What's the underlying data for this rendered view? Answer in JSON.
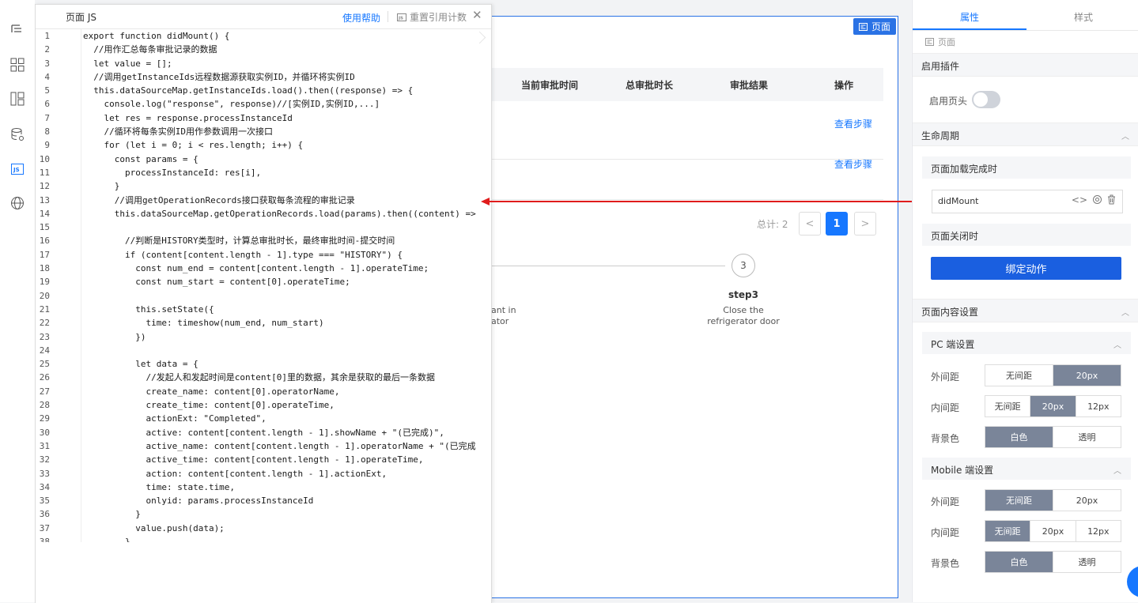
{
  "editor": {
    "title": "页面 JS",
    "help": "使用帮助",
    "reset": "重置引用计数",
    "close": "✕",
    "reset_icon": "JS",
    "lines": [
      "export function didMount() {",
      "  //用作汇总每条审批记录的数据",
      "  let value = [];",
      "  //调用getInstanceIds远程数据源获取实例ID，并循环将实例ID",
      "  this.dataSourceMap.getInstanceIds.load().then((response) => {",
      "    console.log(\"response\", response)//[实例ID,实例ID,...]",
      "    let res = response.processInstanceId",
      "    //循环将每条实例ID用作参数调用一次接口",
      "    for (let i = 0; i < res.length; i++) {",
      "      const params = {",
      "        processInstanceId: res[i],",
      "      }",
      "      //调用getOperationRecords接口获取每条流程的审批记录",
      "      this.dataSourceMap.getOperationRecords.load(params).then((content) =>",
      "",
      "        //判断是HISTORY类型时，计算总审批时长，最终审批时间-提交时间",
      "        if (content[content.length - 1].type === \"HISTORY\") {",
      "          const num_end = content[content.length - 1].operateTime;",
      "          const num_start = content[0].operateTime;",
      "",
      "          this.setState({",
      "            time: timeshow(num_end, num_start)",
      "          })",
      "",
      "          let data = {",
      "            //发起人和发起时间是content[0]里的数据，其余是获取的最后一条数据",
      "            create_name: content[0].operatorName,",
      "            create_time: content[0].operateTime,",
      "            actionExt: \"Completed\",",
      "            active: content[content.length - 1].showName + \"(已完成)\",",
      "            active_name: content[content.length - 1].operatorName + \"(已完成",
      "            active_time: content[content.length - 1].operateTime,",
      "            action: content[content.length - 1].actionExt,",
      "            time: state.time,",
      "            onlyid: params.processInstanceId",
      "          }",
      "          value.push(data);",
      "        }"
    ],
    "line_numbers": [
      "1",
      "2",
      "3",
      "4",
      "5",
      "6",
      "7",
      "8",
      "9",
      "10",
      "11",
      "12",
      "13",
      "14",
      "15",
      "16",
      "17",
      "18",
      "19",
      "20",
      "21",
      "22",
      "23",
      "24",
      "25",
      "26",
      "27",
      "28",
      "29",
      "30",
      "31",
      "32",
      "33",
      "34",
      "35",
      "36",
      "37",
      "38"
    ]
  },
  "canvas": {
    "page_badge": "页面",
    "columns": [
      "当前审批时间",
      "总审批时长",
      "审批结果",
      "操作"
    ],
    "row_action": "查看步骤",
    "total": "总计: 2",
    "page_prev": "<",
    "page_current": "1",
    "page_next": ">",
    "step_number": "3",
    "step_title": "step3",
    "step_desc": "Close the refrigerator door",
    "cut_desc_1": "ant in",
    "cut_desc_2": "ator"
  },
  "panel": {
    "tab_props": "属性",
    "tab_style": "样式",
    "crumb": "页面",
    "sec_plugins": "启用插件",
    "enable_header": "启用页头",
    "enable_header_on": false,
    "sec_lifecycle": "生命周期",
    "on_load": "页面加载完成时",
    "fn_name": "didMount",
    "on_close": "页面关闭时",
    "bind_action": "绑定动作",
    "sec_content": "页面内容设置",
    "pc_title": "PC 端设置",
    "mobile_title": "Mobile 端设置",
    "margin": "外间距",
    "padding": "内间距",
    "bg": "背景色",
    "opt_none": "无间距",
    "opt_20": "20px",
    "opt_12": "12px",
    "opt_white": "白色",
    "opt_transparent": "透明",
    "chevron_up": "︿"
  },
  "colors": {
    "accent": "#1677ff",
    "highlight_red": "#e01c1c",
    "selected_seg": "#7a8599"
  },
  "icons": [
    "outline-tree-icon",
    "components-icon",
    "page-layout-icon",
    "datasource-icon",
    "js-icon",
    "globe-icon"
  ]
}
